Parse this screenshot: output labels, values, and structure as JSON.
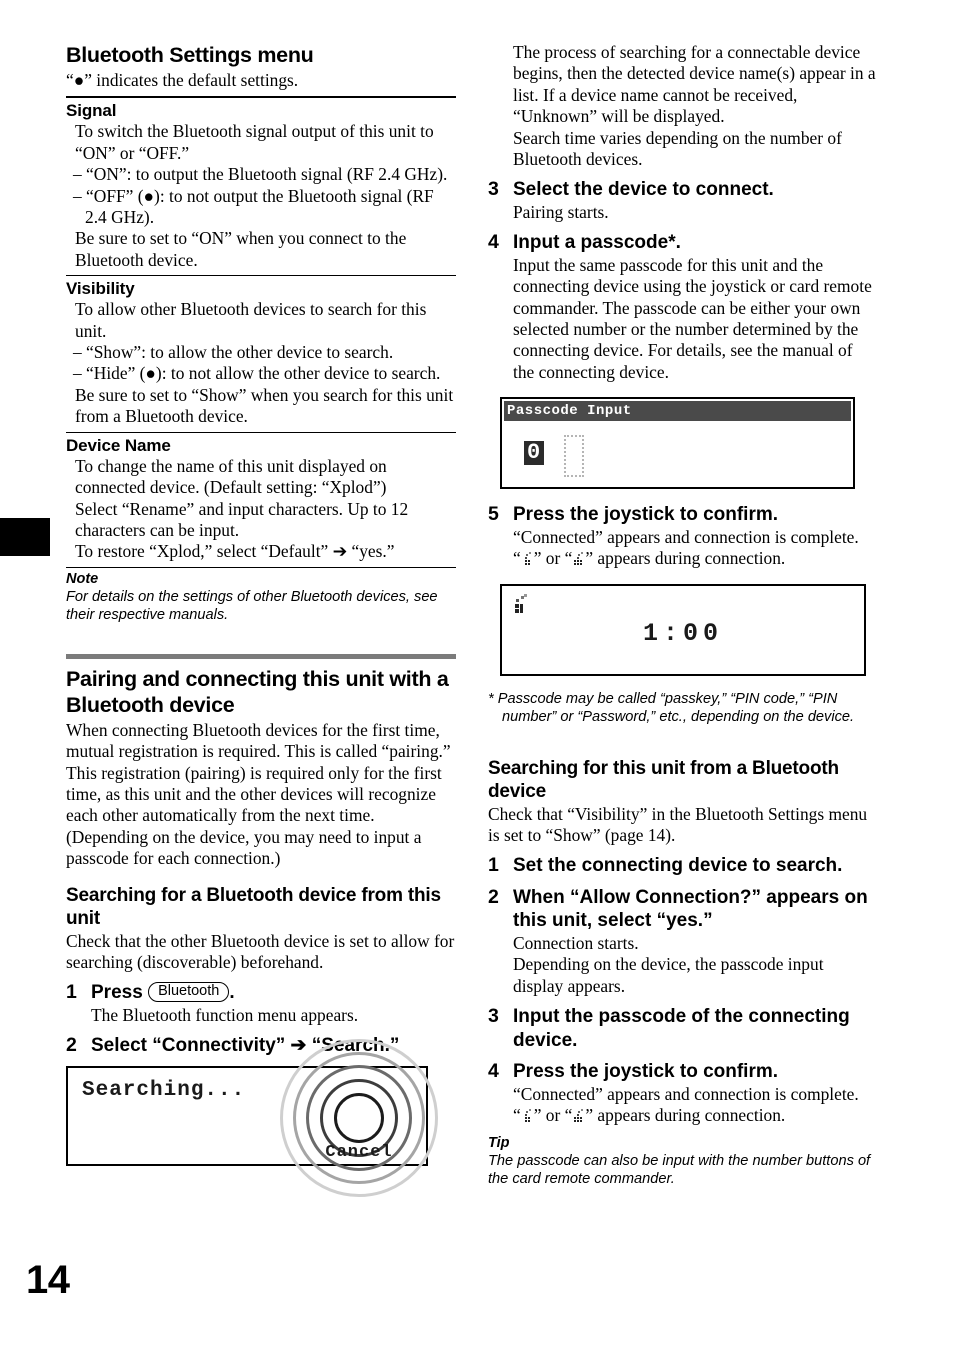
{
  "page": {
    "number": "14"
  },
  "left": {
    "title": "Bluetooth Settings menu",
    "subtitle": "“●” indicates the default settings.",
    "sections": [
      {
        "heading": "Signal",
        "lines": [
          "To switch the Bluetooth signal output of this unit to “ON” or “OFF.”",
          "– “ON”: to output the Bluetooth signal (RF 2.4 GHz).",
          "– “OFF” (●): to not output the Bluetooth signal (RF 2.4 GHz).",
          "Be sure to set to “ON” when you connect to the Bluetooth device."
        ]
      },
      {
        "heading": "Visibility",
        "lines": [
          "To allow other Bluetooth devices to search for this unit.",
          "– “Show”: to allow the other device to search.",
          "– “Hide” (●): to not allow the other device to search.",
          "Be sure to set to “Show” when you search for this unit from a Bluetooth device."
        ]
      },
      {
        "heading": "Device Name",
        "lines": [
          "To change the name of this unit displayed on connected device. (Default setting: “Xplod”)",
          "Select “Rename” and input characters. Up to 12 characters can be input.",
          "To restore “Xplod,” select “Default” ➔ “yes.”"
        ]
      }
    ],
    "note": {
      "heading": "Note",
      "body": "For details on the settings of other Bluetooth devices, see their respective manuals."
    },
    "pairing": {
      "heading": "Pairing and connecting this unit with a Bluetooth device",
      "body": "When connecting Bluetooth devices for the first time, mutual registration is required. This is called “pairing.” This registration (pairing) is required only for the first time, as this unit and the other devices will recognize each other automatically from the next time. (Depending on the device, you may need to input a passcode for each connection.)"
    },
    "searching": {
      "heading": "Searching for a Bluetooth device from this unit",
      "body": "Check that the other Bluetooth device is set to allow for searching (discoverable) beforehand.",
      "step1": {
        "num": "1",
        "title_before": "Press",
        "key_label": "Bluetooth",
        "title_after": ".",
        "body": "The Bluetooth function menu appears."
      },
      "step2": {
        "num": "2",
        "title": "Select “Connectivity” ➔ “Search.”"
      }
    },
    "lcd_search": {
      "status_text": "Searching...",
      "cancel_label": "Cancel"
    }
  },
  "right": {
    "intro": [
      "The process of searching for a connectable device begins, then the detected device name(s) appear in a list. If a device name cannot be received, “Unknown” will be displayed.",
      "Search time varies depending on the number of Bluetooth devices."
    ],
    "step3": {
      "num": "3",
      "title": "Select the device to connect.",
      "body": "Pairing starts."
    },
    "step4": {
      "num": "4",
      "title": "Input a passcode*.",
      "body": "Input the same passcode for this unit and the connecting device using the joystick or card remote commander. The passcode can be either your own selected number or the number determined by the connecting device. For details, see the manual of the connecting device."
    },
    "lcd_passcode": {
      "titlebar_text": "Passcode Input",
      "digit": "0"
    },
    "step5": {
      "num": "5",
      "title": "Press the joystick to confirm.",
      "body1": "“Connected” appears and connection is complete.",
      "body2_pre": "“",
      "body2_mid": "” or “",
      "body2_post": "” appears during connection.",
      "icon1": "bt-phone-icon",
      "icon2": "bt-device-icon"
    },
    "lcd_clock": {
      "icon": "bt-phone-icon",
      "time": "1:00"
    },
    "footnote": "* Passcode may be called “passkey,” “PIN code,” “PIN number” or “Password,” etc., depending on the device.",
    "search_unit": {
      "heading": "Searching for this unit from a Bluetooth device",
      "body": "Check that “Visibility” in the Bluetooth Settings menu is set to “Show” (page 14).",
      "step1": {
        "num": "1",
        "title": "Set the connecting device to search."
      },
      "step2": {
        "num": "2",
        "title": "When “Allow Connection?” appears on this unit, select “yes.”",
        "body": "Connection starts.\nDepending on the device, the passcode input display appears."
      },
      "step3": {
        "num": "3",
        "title": "Input the passcode of the connecting device."
      },
      "step4": {
        "num": "4",
        "title": "Press the joystick to confirm.",
        "body1": "“Connected” appears and connection is complete.",
        "body2_pre": "“",
        "body2_mid": "” or “",
        "body2_post": "” appears during connection."
      }
    },
    "tip": {
      "heading": "Tip",
      "body": "The passcode can also be input with the number buttons of the card remote commander."
    }
  }
}
